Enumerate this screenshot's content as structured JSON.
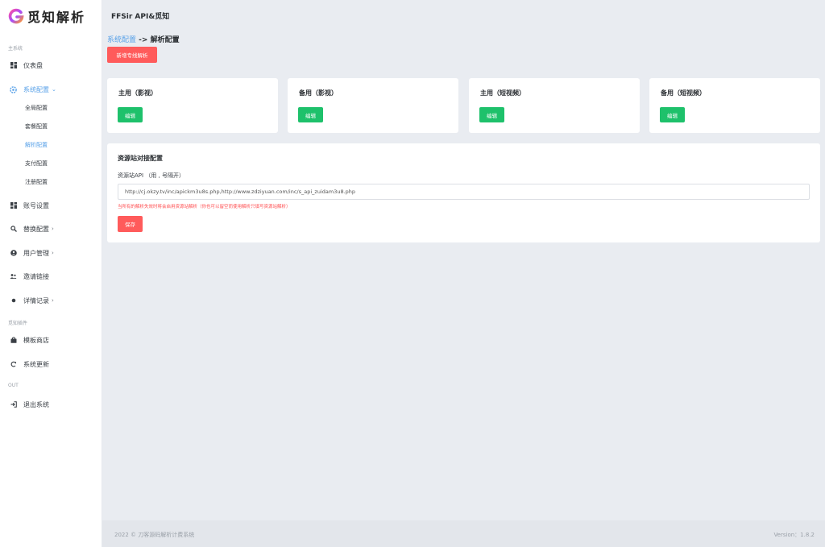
{
  "app": {
    "logo_text": "觅知解析",
    "header_title": "FFSir API&觅知"
  },
  "sidebar": {
    "section_main": "主系统",
    "section_store": "觅知插件",
    "section_out": "OUT",
    "items": [
      {
        "label": "仪表盘",
        "icon": "dashboard-icon"
      },
      {
        "label": "系统配置",
        "icon": "settings-icon",
        "chevron": "⌄",
        "active": true
      },
      {
        "label": "账号设置",
        "icon": "grid-icon"
      },
      {
        "label": "替换配置",
        "icon": "search-icon",
        "chevron": "›"
      },
      {
        "label": "用户管理",
        "icon": "user-circle-icon",
        "chevron": "›"
      },
      {
        "label": "邀请链接",
        "icon": "users-icon"
      },
      {
        "label": "详情记录",
        "icon": "dot-icon",
        "chevron": "›"
      },
      {
        "label": "模板商店",
        "icon": "bag-icon"
      },
      {
        "label": "系统更新",
        "icon": "refresh-icon"
      },
      {
        "label": "退出系统",
        "icon": "logout-icon"
      }
    ],
    "sub_items": [
      {
        "label": "全局配置"
      },
      {
        "label": "套餐配置"
      },
      {
        "label": "解析配置",
        "active": true
      },
      {
        "label": "支付配置"
      },
      {
        "label": "注册配置"
      }
    ]
  },
  "breadcrumb": {
    "parent": "系统配置",
    "separator": " -> ",
    "current": "解析配置"
  },
  "add_button_label": "新增专线解析",
  "cards": [
    {
      "title": "主用（影视）",
      "button": "编辑"
    },
    {
      "title": "备用（影视）",
      "button": "编辑"
    },
    {
      "title": "主用（短视频）",
      "button": "编辑"
    },
    {
      "title": "备用（短视频）",
      "button": "编辑"
    }
  ],
  "resource_panel": {
    "title": "资源站对接配置",
    "label": "资源站API （用 , 号隔开）",
    "value": "http://cj.okzy.tv/inc/apickm3u8s.php,http://www.zdziyuan.com/inc/s_api_zuidam3u8.php",
    "hint": "当所有的解析失效时将会启用资源站解析（你也可以留空而使用解析只填写资源站解析）",
    "save_label": "保存"
  },
  "footer": {
    "copyright": "2022 © 刀客源码解析计费系统",
    "version": "Version：1.8.2"
  },
  "colors": {
    "accent": "#5aa2e8",
    "danger": "#ff5b5b",
    "success": "#1ec16b"
  }
}
